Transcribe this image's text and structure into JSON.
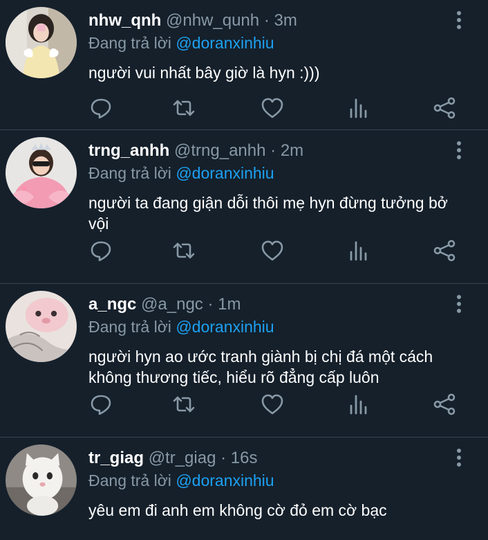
{
  "tweets": [
    {
      "name": "nhw_qnh",
      "handle": "@nhw_qunh",
      "dot": "·",
      "time": "3m",
      "reply_prefix": "Đang trả lời",
      "reply_to": "@doranxinhiu",
      "text": "người vui nhất bây giờ là hyn :)))"
    },
    {
      "name": "trng_anhh",
      "handle": "@trng_anhh",
      "dot": "·",
      "time": "2m",
      "reply_prefix": "Đang trả lời",
      "reply_to": "@doranxinhiu",
      "text": "người ta đang giận dỗi thôi mẹ hyn đừng tưởng bở vội"
    },
    {
      "name": "a_ngc",
      "handle": "@a_ngc",
      "dot": "·",
      "time": "1m",
      "reply_prefix": "Đang trả lời",
      "reply_to": "@doranxinhiu",
      "text": "người hyn ao ước tranh giành bị chị đá một cách không thương tiếc, hiểu rõ đẳng cấp luôn"
    },
    {
      "name": "tr_giag",
      "handle": "@tr_giag",
      "dot": "·",
      "time": "16s",
      "reply_prefix": "Đang trả lời",
      "reply_to": "@doranxinhiu",
      "text": "yêu em đi anh em không cờ đỏ em cờ bạc"
    }
  ],
  "icons": {
    "reply": "reply-icon",
    "retweet": "retweet-icon",
    "like": "heart-icon",
    "stats": "analytics-icon",
    "share": "share-icon",
    "more": "more-vertical-icon"
  },
  "colors": {
    "background": "#15202b",
    "muted": "#8899a6",
    "mention": "#1da1f2",
    "divider": "#38444d"
  }
}
